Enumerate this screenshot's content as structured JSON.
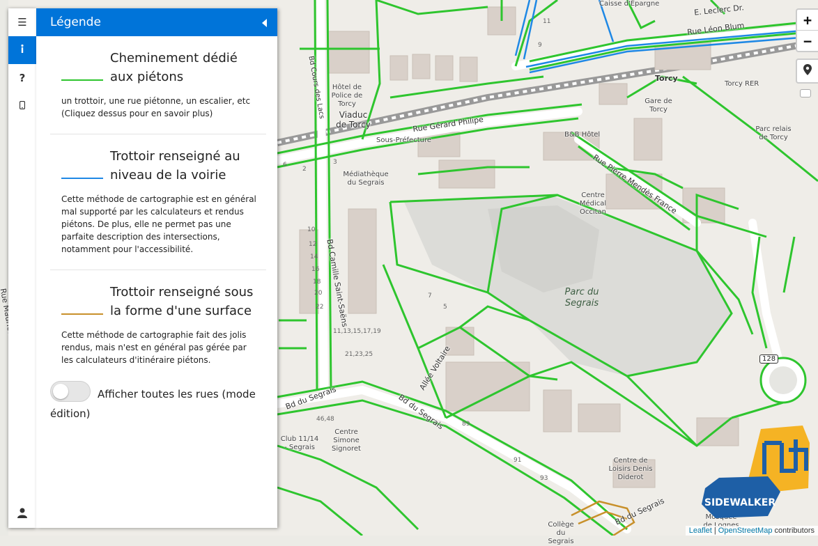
{
  "legend": {
    "title": "Légende",
    "items": [
      {
        "title": "Cheminement dédié aux piétons",
        "color": "#2ec52e",
        "desc": "un trottoir, une rue piétonne, un escalier, etc (Cliquez dessus pour en savoir plus)"
      },
      {
        "title": "Trottoir renseigné au niveau de la voirie",
        "color": "#1e88e5",
        "desc": "Cette méthode de cartographie est en général mal supporté par les calculateurs et rendus piétons. De plus, elle ne permet pas une parfaite description des intersections, notamment pour l'accessibilité."
      },
      {
        "title": "Trottoir renseigné sous la forme d'une surface",
        "color": "#c8902a",
        "desc": "Cette méthode de cartographie fait des jolis rendus, mais n'est en général pas gérée par les calculateurs d'itinéraire piétons."
      }
    ],
    "toggle_label": "Afficher toutes les rues (mode édition)",
    "toggle_on": false
  },
  "sidebar": {
    "tabs": [
      {
        "icon": "menu-icon",
        "glyph": "☰"
      },
      {
        "icon": "info-icon",
        "glyph": "ℹ",
        "active": true
      },
      {
        "icon": "question-icon",
        "glyph": "?"
      },
      {
        "icon": "mobile-icon",
        "glyph": "▯"
      }
    ],
    "bottom_icon": "user-icon"
  },
  "controls": {
    "zoom_in": "+",
    "zoom_out": "−"
  },
  "map": {
    "streets": [
      "E. Leclerc Dr.",
      "Rue Léon Blum",
      "Bd Cours des Lacs",
      "Viaduc de Torcy",
      "Rue Gérard Philipe",
      "Rue Pierre Mendès France",
      "Bd Camille Saint-Saëns",
      "Allée Voltaire",
      "Bd du Segrais",
      "Rue Maurice Ravel",
      "Torcy"
    ],
    "pois": [
      "Caisse d'Épargne",
      "Hôtel de Police de Torcy",
      "Sous-Préfecture",
      "Médiathèque du Segrais",
      "B&B Hôtel",
      "Gare de Torcy",
      "Parc relais de Torcy",
      "Centre Médical Occitan",
      "Club 11/14 - Segrais",
      "Centre Simone Signoret",
      "Centre de Loisirs Denis Diderot",
      "Mosquée de Lognes",
      "Collège du Segrais",
      "Torcy RER",
      "Parc du Segrais"
    ],
    "house_numbers": [
      "11",
      "9",
      "2",
      "6",
      "3",
      "10",
      "12",
      "14",
      "16",
      "18",
      "20",
      "22",
      "7",
      "5",
      "11,13,15,17,19",
      "21,23,25",
      "46,48",
      "89",
      "91",
      "93",
      "128"
    ]
  },
  "attribution": {
    "leaflet": "Leaflet",
    "sep": "|",
    "osm": "OpenStreetMap",
    "suffix": "contributors"
  },
  "logo": {
    "text": "SIDEWALKER",
    "colors": [
      "#f5b324",
      "#1e5fa6"
    ]
  }
}
